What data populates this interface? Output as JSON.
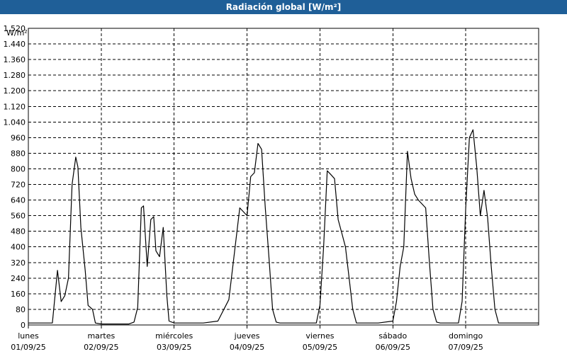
{
  "window": {
    "title": "Radiación global [W/m²]"
  },
  "chart_data": {
    "type": "line",
    "title": "Radiación global [W/m²]",
    "ylabel": "W/m²",
    "xlabel": "",
    "ylim": [
      0,
      1520
    ],
    "yticks": [
      0,
      80,
      160,
      240,
      320,
      400,
      480,
      560,
      640,
      720,
      800,
      880,
      960,
      1040,
      1120,
      1200,
      1280,
      1360,
      1440,
      1520
    ],
    "ytick_labels": [
      "0",
      "80",
      "160",
      "240",
      "320",
      "400",
      "480",
      "560",
      "640",
      "720",
      "800",
      "880",
      "960",
      "1.040",
      "1.120",
      "1.200",
      "1.280",
      "1.360",
      "1.440",
      "1.520"
    ],
    "xlim": [
      0,
      7
    ],
    "days": [
      {
        "weekday": "lunes",
        "date": "01/09/25"
      },
      {
        "weekday": "martes",
        "date": "02/09/25"
      },
      {
        "weekday": "miércoles",
        "date": "03/09/25"
      },
      {
        "weekday": "jueves",
        "date": "04/09/25"
      },
      {
        "weekday": "viernes",
        "date": "05/09/25"
      },
      {
        "weekday": "sábado",
        "date": "06/09/25"
      },
      {
        "weekday": "domingo",
        "date": "07/09/25"
      }
    ],
    "grid": true,
    "series": [
      {
        "color": "#000000",
        "x": [
          0,
          0.33,
          0.4,
          0.45,
          0.5,
          0.55,
          0.6,
          0.65,
          0.68,
          0.72,
          0.78,
          0.82,
          0.88,
          0.92,
          1.0,
          1.1,
          1.38,
          1.45,
          1.5,
          1.55,
          1.58,
          1.63,
          1.68,
          1.72,
          1.75,
          1.8,
          1.85,
          1.9,
          1.93,
          2.0,
          2.05,
          2.1,
          2.2,
          2.4,
          2.6,
          2.75,
          2.9,
          3.0,
          3.05,
          3.1,
          3.15,
          3.2,
          3.25,
          3.3,
          3.35,
          3.4,
          3.45,
          3.5,
          3.55,
          3.6,
          3.75,
          3.8,
          3.95,
          4.0,
          4.05,
          4.1,
          4.15,
          4.2,
          4.25,
          4.3,
          4.35,
          4.4,
          4.45,
          4.5,
          4.6,
          4.8,
          5.0,
          5.05,
          5.1,
          5.15,
          5.2,
          5.25,
          5.3,
          5.35,
          5.45,
          5.5,
          5.55,
          5.6,
          5.65,
          5.7,
          5.78,
          5.85,
          5.9,
          5.95,
          6.0,
          6.05,
          6.1,
          6.15,
          6.2,
          6.25,
          6.3,
          6.35,
          6.4,
          6.45,
          6.5,
          6.55,
          6.6,
          6.8,
          7.0
        ],
        "values": [
          10,
          10,
          280,
          120,
          150,
          240,
          720,
          860,
          810,
          500,
          280,
          100,
          80,
          10,
          5,
          5,
          5,
          15,
          90,
          600,
          610,
          300,
          540,
          555,
          380,
          350,
          500,
          150,
          20,
          10,
          10,
          10,
          10,
          10,
          20,
          130,
          600,
          560,
          760,
          780,
          930,
          900,
          600,
          350,
          80,
          15,
          10,
          10,
          10,
          10,
          10,
          10,
          10,
          100,
          400,
          790,
          770,
          750,
          540,
          470,
          400,
          240,
          80,
          10,
          10,
          10,
          20,
          120,
          300,
          400,
          890,
          750,
          670,
          640,
          600,
          330,
          80,
          15,
          10,
          10,
          10,
          10,
          10,
          120,
          600,
          960,
          1000,
          810,
          560,
          690,
          550,
          300,
          80,
          10,
          10,
          10,
          10,
          10,
          10
        ]
      }
    ]
  }
}
